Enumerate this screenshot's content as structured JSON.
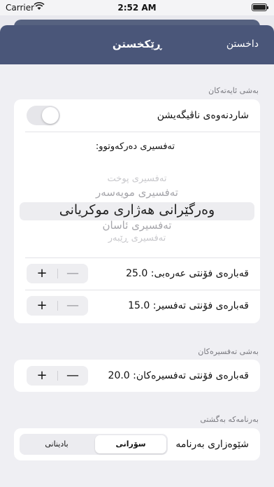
{
  "status": {
    "carrier": "Carrier",
    "time": "2:52 AM"
  },
  "nav": {
    "title": "ڕێکخستن",
    "close_label": "داخستن"
  },
  "sections": {
    "verse": "بەشی ئایەتەکان",
    "tafsir": "بەشی تەفسیرەکان",
    "app": "بەرنامەکە بەگشتی"
  },
  "verse": {
    "toggle_label": "شاردنەوەی ناڤیگەیشن",
    "toggle_on": false,
    "picker_label": "تەفسیری دەرکەوتوو:",
    "picker_options": [
      "تەفسیری پوخت",
      "تەفسیری مویەسەر",
      "وەرگێرانی هەژاری موکریانی",
      "تەفسیری ئاسان",
      "تەفسیری ڕێبەر"
    ],
    "picker_selected": "وەرگێرانی هەژاری موکریانی",
    "arabic_font_label": "قەبارەی فۆنتی عەرەبی: 25.0",
    "tafsir_font_label": "قەبارەی فۆنتی تەفسیر: 15.0"
  },
  "tafsir": {
    "font_label": "قەبارەی فۆنتی تەفسیرەکان: 20.0"
  },
  "app": {
    "program_mode_label": "شێوەزاری بەرنامە",
    "segments": [
      "سۆرانی",
      "بادینانی"
    ],
    "selected_segment": "سۆرانی"
  },
  "stepper": {
    "plus": "+",
    "minus": "—"
  }
}
